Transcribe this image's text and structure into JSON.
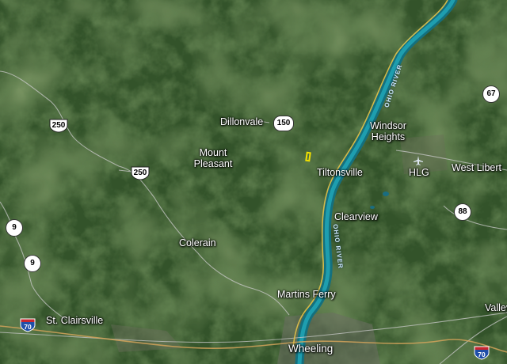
{
  "map": {
    "type": "satellite",
    "places": {
      "dillonvale": "Dillonvale",
      "mount_pleasant": "Mount\nPleasant",
      "tiltonsville": "Tiltonsville",
      "windsor_heights": "Windsor\nHeights",
      "west_liberty": "West Libert",
      "clearview": "Clearview",
      "colerain": "Colerain",
      "martins_ferry": "Martins Ferry",
      "st_clairsville": "St. Clairsville",
      "wheeling": "Wheeling",
      "valley": "Valley"
    },
    "airport_code": "HLG",
    "river_name": "OHIO RIVER",
    "routes": {
      "us250_a": "250",
      "us250_b": "250",
      "oh150": "150",
      "oh9_a": "9",
      "oh9_b": "9",
      "wv67": "67",
      "wv88": "88",
      "i70_a": "70",
      "i70_b": "70"
    },
    "colors": {
      "terrain": "#2c4a22",
      "river": "#1a8fa0",
      "highlight_road": "#e2c14a",
      "marker": "#f2e000"
    }
  }
}
